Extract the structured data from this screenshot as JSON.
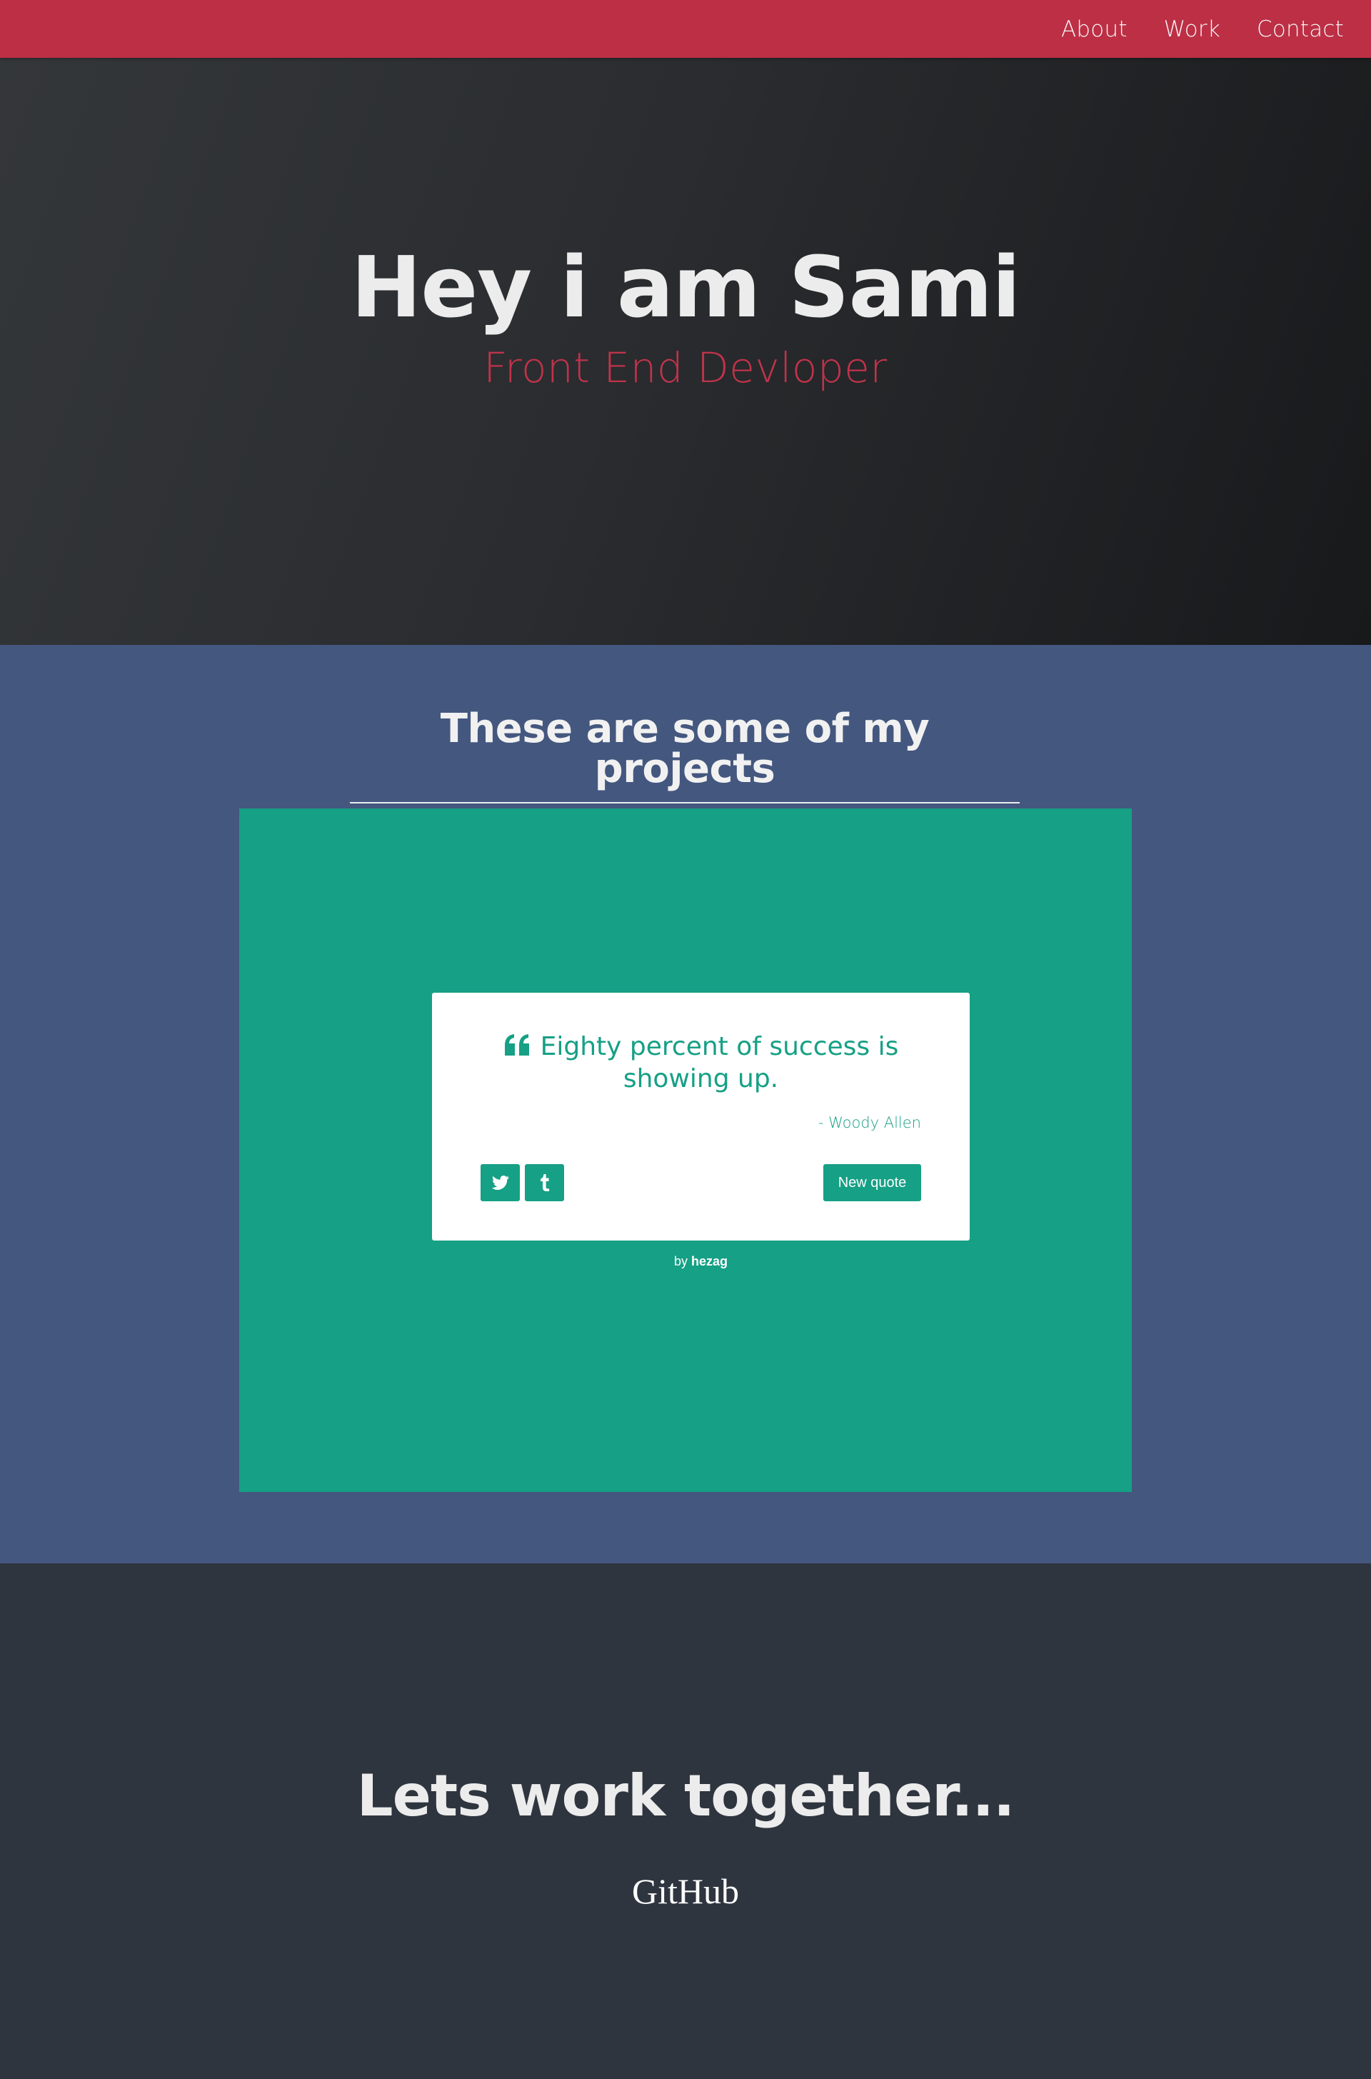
{
  "nav": {
    "links": [
      "About",
      "Work",
      "Contact"
    ]
  },
  "hero": {
    "title": "Hey i am Sami",
    "subtitle": "Front End Devloper"
  },
  "projects": {
    "heading": "These are some of my projects",
    "quote_app": {
      "quote": "Eighty percent of success is showing up.",
      "author": "- Woody Allen",
      "new_quote_label": "New quote",
      "share_icons": [
        "twitter-icon",
        "tumblr-icon"
      ],
      "credit_prefix": "by ",
      "credit_link": "hezag",
      "accent_color": "#16a085"
    }
  },
  "contact": {
    "heading": "Lets work together...",
    "link": "GitHub"
  },
  "colors": {
    "navbar": "#bd2f45",
    "hero_bg": "#2a2c2f",
    "projects_bg": "#44577f",
    "contact_bg": "#2f353f",
    "subtitle": "#c0334a"
  }
}
